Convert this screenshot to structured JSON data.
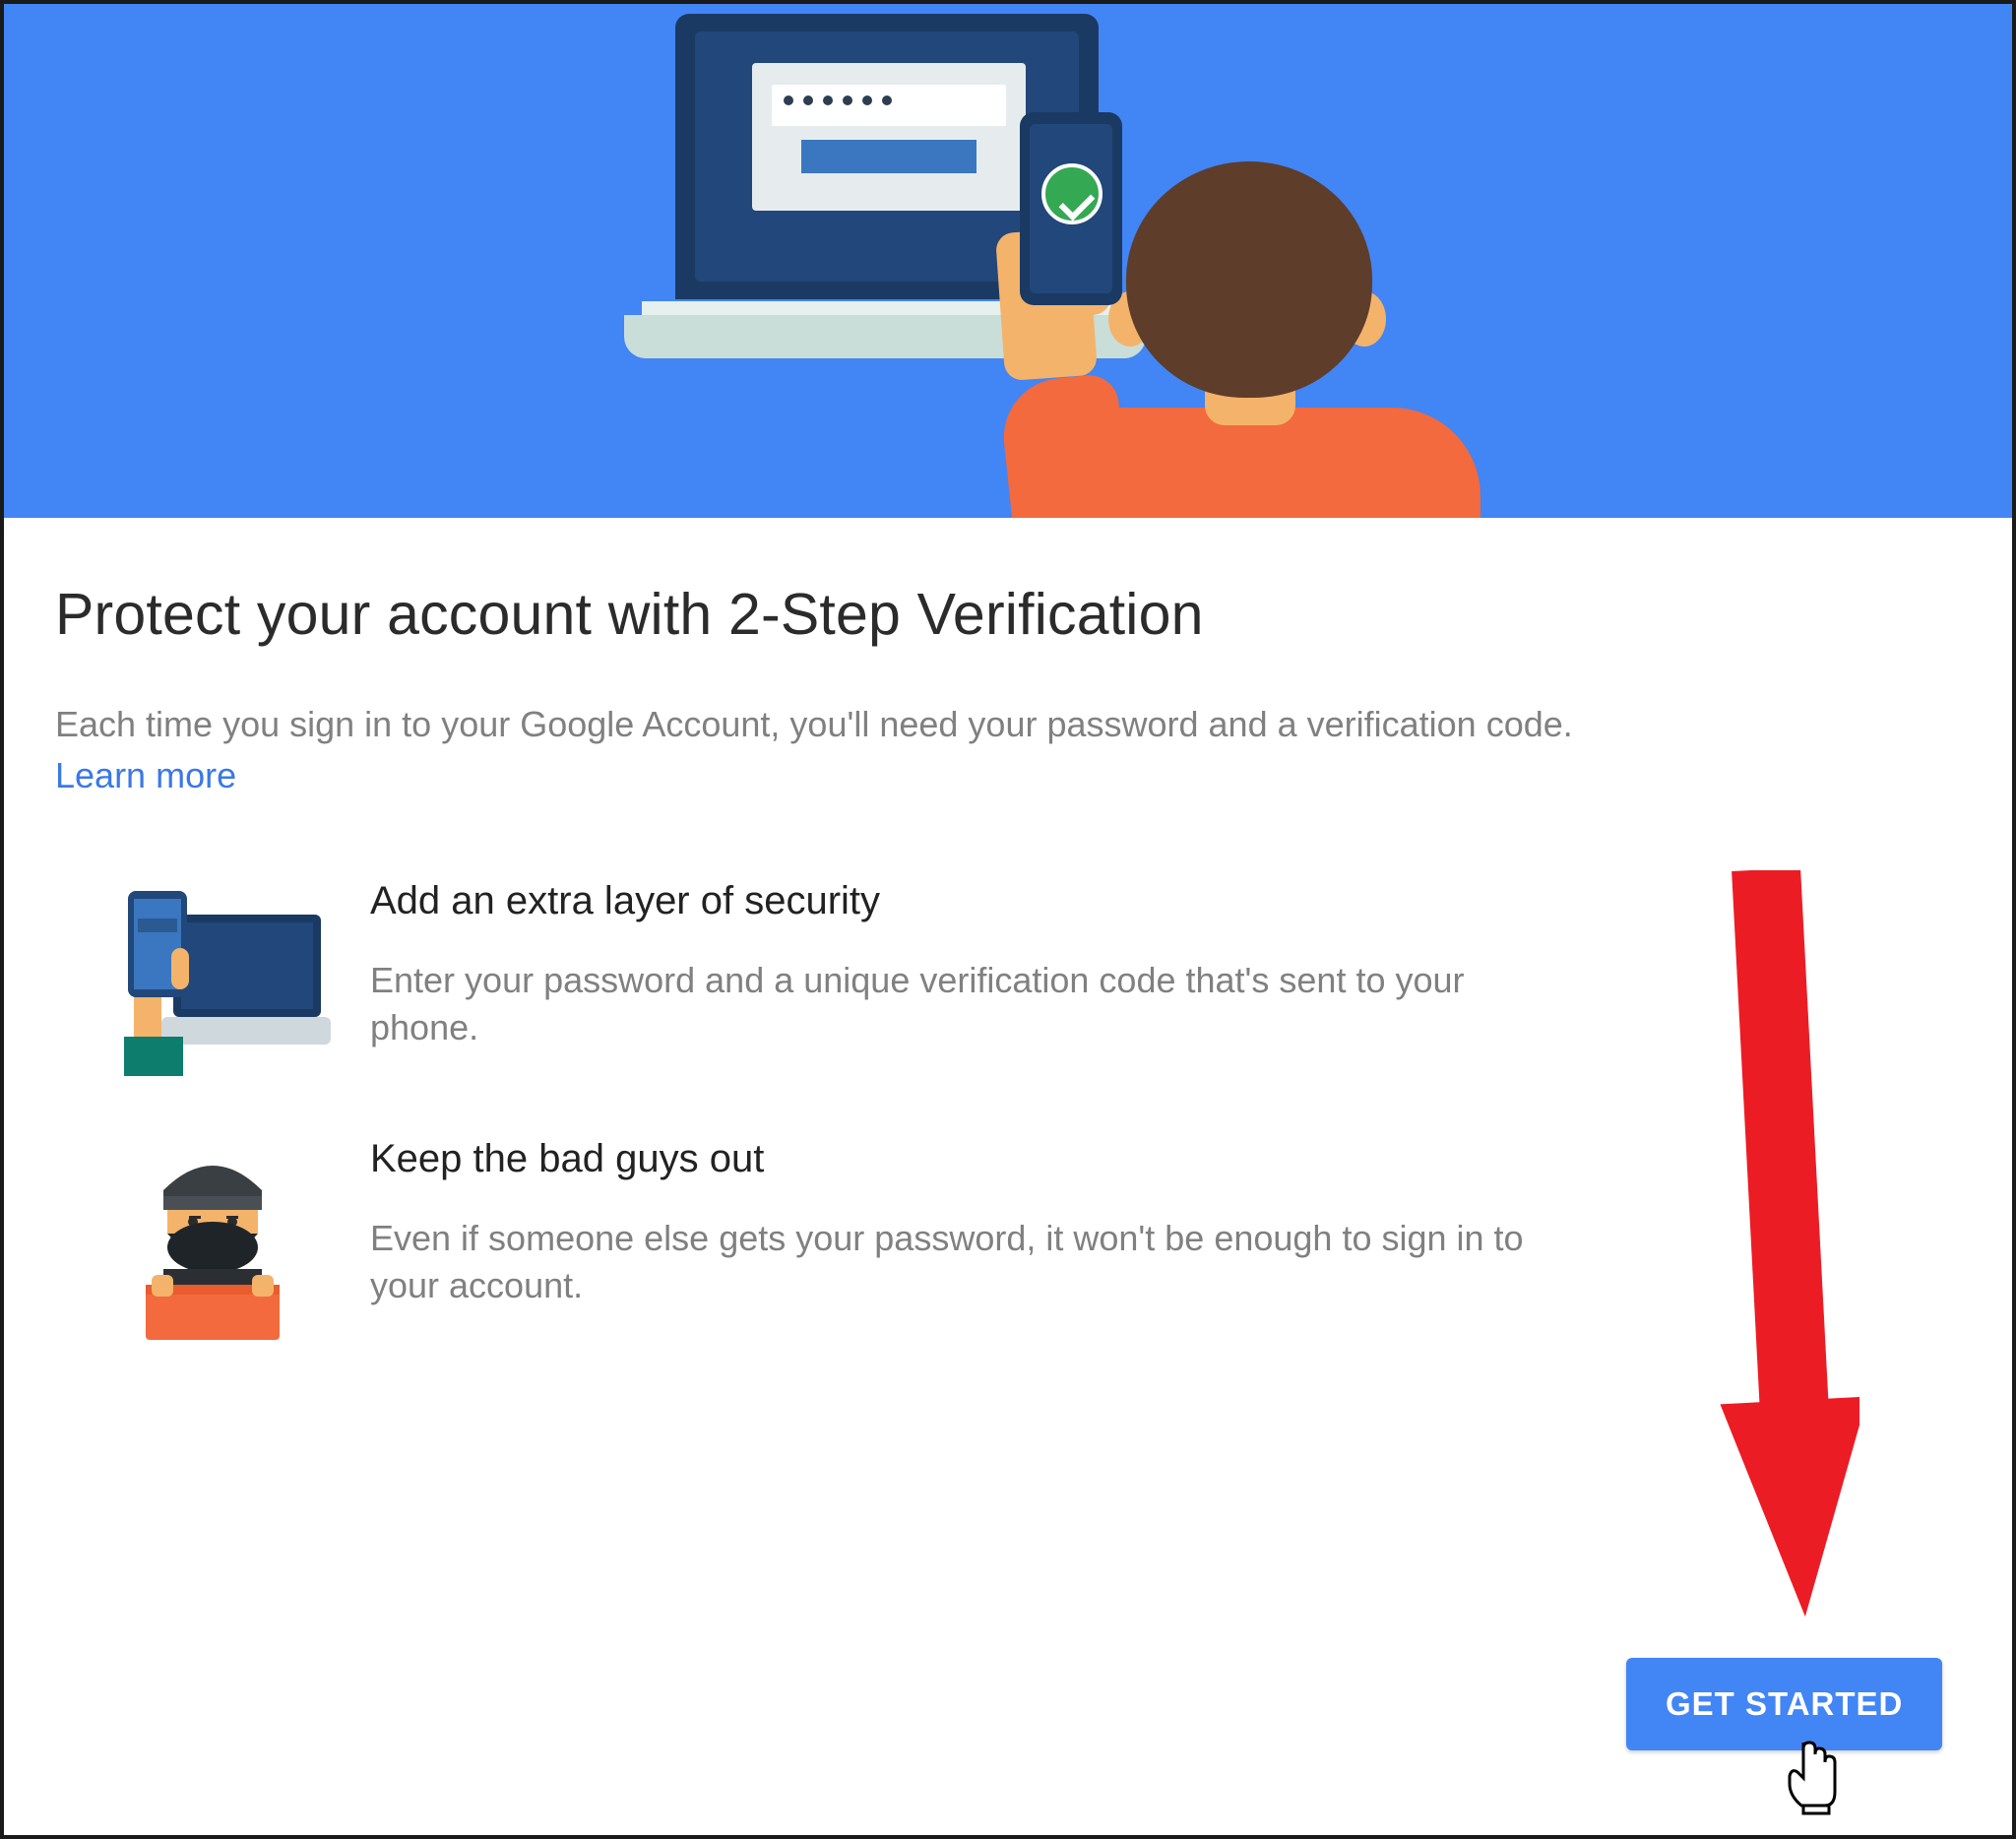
{
  "colors": {
    "accent": "#4285f4",
    "green": "#34a853",
    "orange_shirt": "#f26a3d",
    "link": "#3b78e7",
    "arrow": "#ec1c24"
  },
  "page": {
    "title": "Protect your account with 2-Step Verification",
    "subtitle": "Each time you sign in to your Google Account, you'll need your password and a verification code.",
    "learn_more": "Learn more"
  },
  "features": [
    {
      "title": "Add an extra layer of security",
      "desc": "Enter your password and a unique verification code that's sent to your phone."
    },
    {
      "title": "Keep the bad guys out",
      "desc": "Even if someone else gets your password, it won't be enough to sign in to your account."
    }
  ],
  "cta": {
    "label": "GET STARTED"
  }
}
